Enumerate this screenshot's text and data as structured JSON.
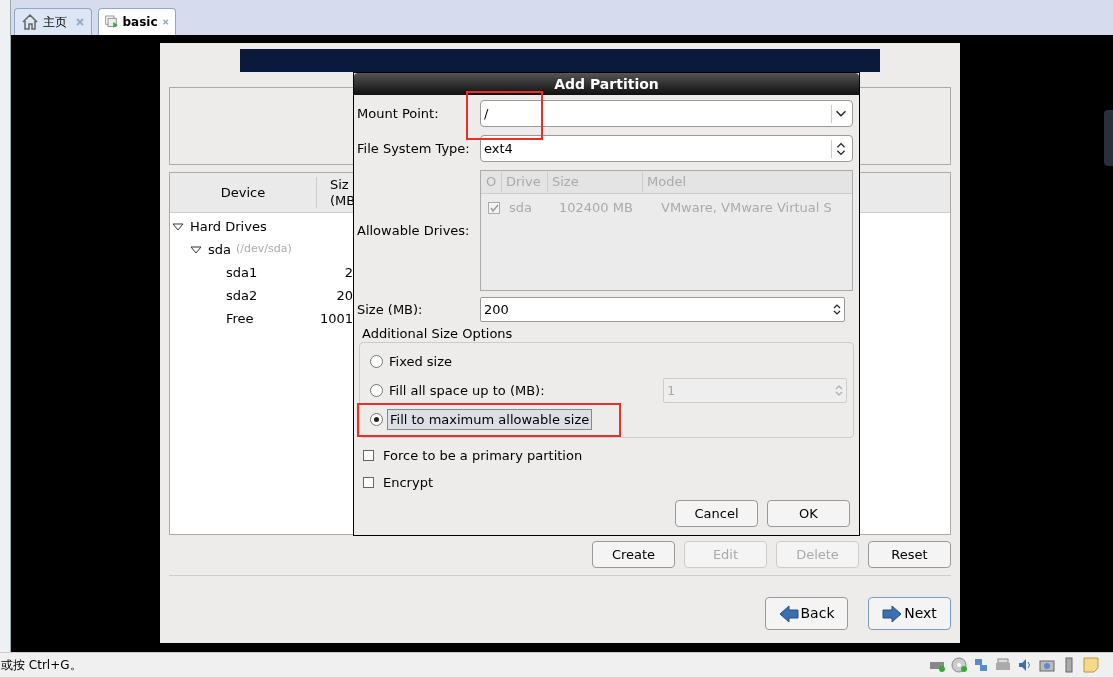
{
  "tabs": [
    {
      "label": "主页",
      "selected": false
    },
    {
      "label": "basic",
      "selected": true
    }
  ],
  "installer": {
    "device_table": {
      "columns": [
        "Device",
        "Siz\n(MB"
      ],
      "rows": [
        {
          "device": "Hard Drives",
          "expanded": true,
          "children": [
            {
              "device": "sda",
              "note": "(/dev/sda)",
              "expanded": true,
              "children": [
                {
                  "device": "sda1",
                  "size": "2"
                },
                {
                  "device": "sda2",
                  "size": "20"
                },
                {
                  "device": "Free",
                  "size": "1001"
                }
              ]
            }
          ]
        }
      ]
    },
    "buttons": [
      {
        "label": "Create",
        "disabled": false
      },
      {
        "label": "Edit",
        "disabled": true
      },
      {
        "label": "Delete",
        "disabled": true
      },
      {
        "label": "Reset",
        "disabled": false
      }
    ],
    "nav": [
      {
        "label": "Back",
        "kind": "back"
      },
      {
        "label": "Next",
        "kind": "next"
      }
    ]
  },
  "dialog": {
    "title": "Add Partition",
    "mount_point": {
      "label": "Mount Point:",
      "value": "/"
    },
    "file_system_type": {
      "label": "File System Type:",
      "value": "ext4"
    },
    "allowable_drives": {
      "label": "Allowable Drives:",
      "columns": [
        "O",
        "Drive",
        "Size",
        "Model"
      ],
      "rows": [
        {
          "checked": true,
          "drive": "sda",
          "size": "102400 MB",
          "model": "VMware, VMware Virtual S"
        }
      ]
    },
    "size": {
      "label": "Size (MB):",
      "value": "200"
    },
    "size_options": {
      "title": "Additional Size Options",
      "options": [
        {
          "label": "Fixed size",
          "selected": false
        },
        {
          "label": "Fill all space up to (MB):",
          "selected": false,
          "field": "1"
        },
        {
          "label": "Fill to maximum allowable size",
          "selected": true
        }
      ]
    },
    "checkboxes": [
      {
        "label": "Force to be a primary partition",
        "checked": false
      },
      {
        "label": "Encrypt",
        "checked": false
      }
    ],
    "buttons": [
      "Cancel",
      "OK"
    ]
  },
  "status_bar": {
    "text": "或按 Ctrl+G。"
  }
}
